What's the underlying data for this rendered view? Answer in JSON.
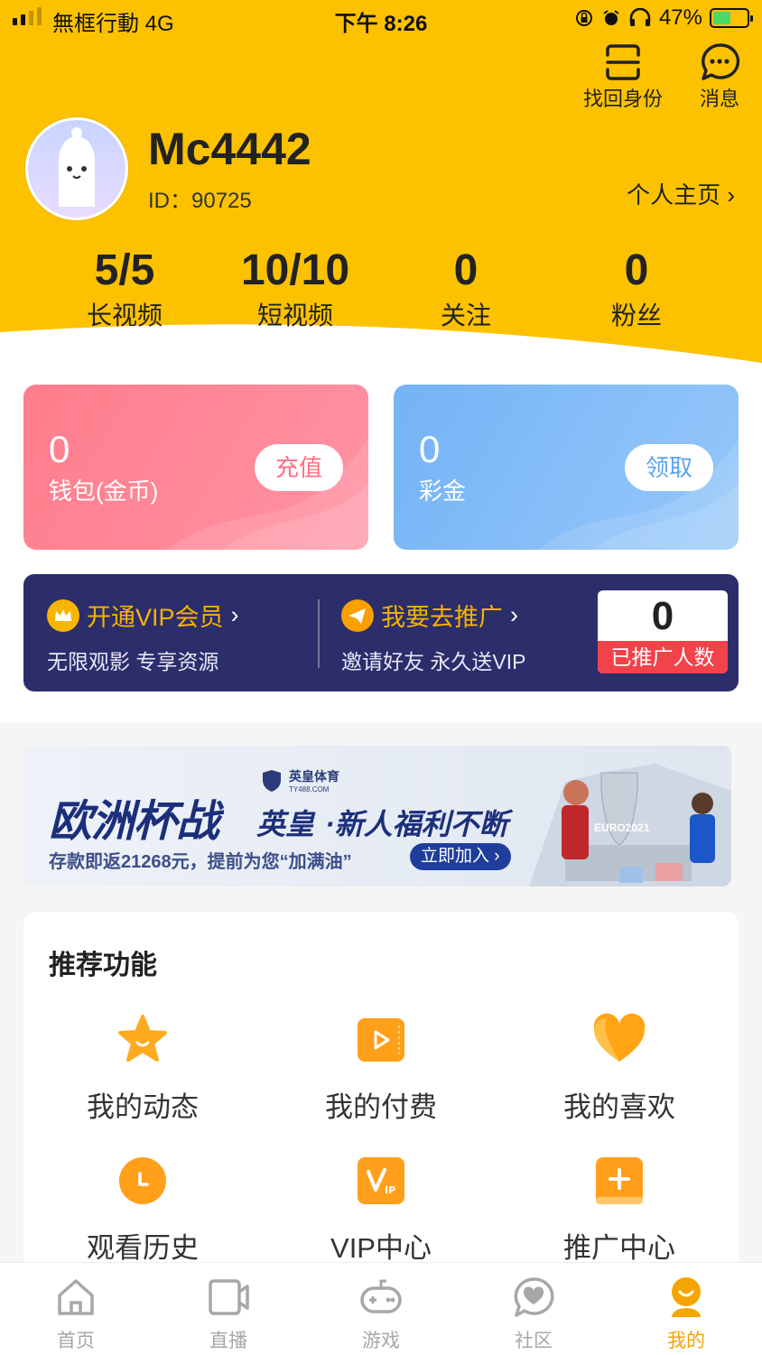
{
  "status_bar": {
    "carrier": "無框行動  4G",
    "time": "下午 8:26",
    "battery": "47%"
  },
  "top_actions": {
    "recover_label": "找回身份",
    "message_label": "消息"
  },
  "profile": {
    "username": "Mc4442",
    "id_text": "ID：90725",
    "homepage_label": "个人主页"
  },
  "stats": [
    {
      "value": "5/5",
      "label": "长视频"
    },
    {
      "value": "10/10",
      "label": "短视频"
    },
    {
      "value": "0",
      "label": "关注"
    },
    {
      "value": "0",
      "label": "粉丝"
    }
  ],
  "wallet": {
    "value": "0",
    "label": "钱包(金币)",
    "button": "充值"
  },
  "bonus": {
    "value": "0",
    "label": "彩金",
    "button": "领取"
  },
  "vip": {
    "title": "开通VIP会员",
    "subtitle": "无限观影 专享资源",
    "promo_title": "我要去推广",
    "promo_subtitle": "邀请好友 永久送VIP",
    "promo_count": "0",
    "promo_count_label": "已推广人数"
  },
  "banner": {
    "headline": "欧洲杯战",
    "brand": "英皇",
    "slogan": "·新人福利不断",
    "logo_text": "英皇体育",
    "logo_sub": "TY488.COM",
    "subline": "存款即返21268元，提前为您“加满油”",
    "cta": "立即加入",
    "badge": "EURO2021"
  },
  "features": {
    "title": "推荐功能",
    "items": [
      {
        "label": "我的动态",
        "icon": "star-icon"
      },
      {
        "label": "我的付费",
        "icon": "play-icon"
      },
      {
        "label": "我的喜欢",
        "icon": "heart-icon"
      },
      {
        "label": "观看历史",
        "icon": "clock-icon"
      },
      {
        "label": "VIP中心",
        "icon": "vip-icon"
      },
      {
        "label": "推广中心",
        "icon": "plus-icon"
      }
    ]
  },
  "tabs": [
    {
      "label": "首页",
      "icon": "home-icon"
    },
    {
      "label": "直播",
      "icon": "video-camera-icon"
    },
    {
      "label": "游戏",
      "icon": "gamepad-icon"
    },
    {
      "label": "社区",
      "icon": "chat-heart-icon"
    },
    {
      "label": "我的",
      "icon": "profile-icon",
      "active": true
    }
  ],
  "colors": {
    "header": "#fcc200",
    "accent": "#f5a500",
    "wallet_card": "#ff7a8a",
    "bonus_card": "#7ab8f5",
    "vip_bar": "#2c2d6b"
  }
}
